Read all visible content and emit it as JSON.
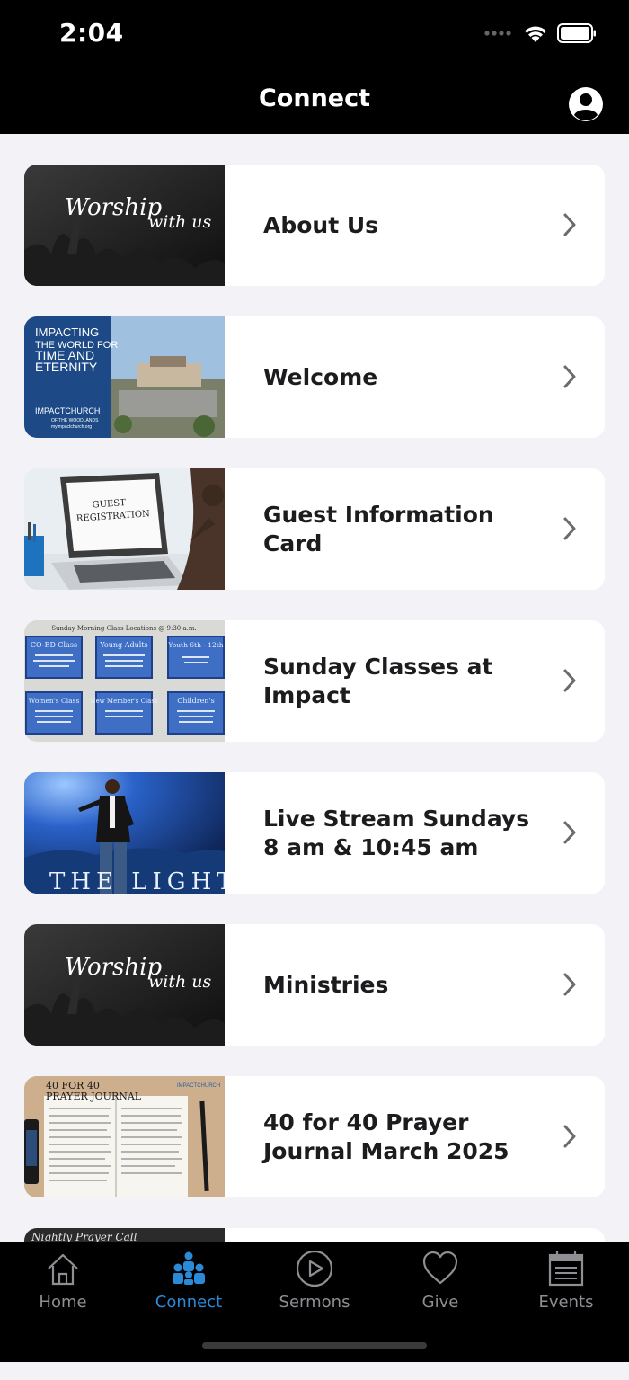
{
  "status": {
    "time": "2:04"
  },
  "header": {
    "title": "Connect"
  },
  "items": [
    {
      "title": "About Us",
      "thumb": {
        "line1": "Worship",
        "line2": "with us"
      }
    },
    {
      "title": "Welcome",
      "thumb": {
        "line1": "IMPACTING",
        "line2": "THE WORLD FOR",
        "line3": "TIME AND",
        "line4": "ETERNITY",
        "brand": "IMPACTCHURCH",
        "sub": "OF THE WOODLANDS",
        "url": "myimpactchurch.org"
      }
    },
    {
      "title": "Guest Information Card",
      "thumb": {
        "line1": "GUEST",
        "line2": "REGISTRATION"
      }
    },
    {
      "title": "Sunday Classes at Impact",
      "thumb": {
        "header": "Sunday Morning Class Locations @ 9:30 a.m.",
        "boxes": [
          {
            "name": "CO-ED Class",
            "loc": "Children's Worship Center"
          },
          {
            "name": "Young Adults",
            "loc": "Children's Building Classroom #1 (1st & 3rd Sunday)"
          },
          {
            "name": "Youth 6th - 12th",
            "loc": "Youth Building"
          },
          {
            "name": "Women's Class",
            "loc": "Children's Building Classroom #2"
          },
          {
            "name": "New Member's Class",
            "loc": "Main Building Welcome Room"
          },
          {
            "name": "Children's",
            "loc": "Children's Building Classroom #3"
          }
        ]
      }
    },
    {
      "title": "Live Stream Sundays 8 am & 10:45 am",
      "thumb": {
        "caption": "THE LIGHT"
      }
    },
    {
      "title": "Ministries",
      "thumb": {
        "line1": "Worship",
        "line2": "with us"
      }
    },
    {
      "title": "40 for 40 Prayer Journal March 2025",
      "thumb": {
        "line1": "40 FOR 40",
        "line2": "PRAYER JOURNAL",
        "brand": "IMPACTCHURCH"
      }
    }
  ],
  "partial_item": {
    "thumb_text": "Nightly Prayer Call"
  },
  "tabs": [
    {
      "label": "Home",
      "icon": "home-icon",
      "active": false
    },
    {
      "label": "Connect",
      "icon": "people-icon",
      "active": true
    },
    {
      "label": "Sermons",
      "icon": "play-icon",
      "active": false
    },
    {
      "label": "Give",
      "icon": "heart-icon",
      "active": false
    },
    {
      "label": "Events",
      "icon": "calendar-icon",
      "active": false
    }
  ],
  "colors": {
    "accent": "#2a8ad8",
    "inactive": "#8e8e93",
    "background": "#f2f2f7"
  }
}
